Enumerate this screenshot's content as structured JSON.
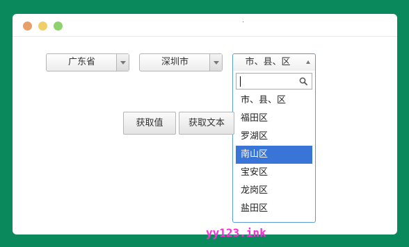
{
  "window": {
    "traffic_lights": [
      {
        "name": "close",
        "color": "#e8a06a"
      },
      {
        "name": "minimize",
        "color": "#f2ce6b"
      },
      {
        "name": "maximize",
        "color": "#8fd16a"
      }
    ]
  },
  "province_select": {
    "value": "广东省"
  },
  "city_select": {
    "value": "深圳市"
  },
  "district_select": {
    "value": "市、县、区",
    "open": true,
    "search_value": "",
    "options": [
      "市、县、区",
      "福田区",
      "罗湖区",
      "南山区",
      "宝安区",
      "龙岗区",
      "盐田区"
    ],
    "highlighted_option": "南山区"
  },
  "buttons": {
    "get_value": "获取值",
    "get_text": "获取文本"
  },
  "watermark": "yy123.ink",
  "colors": {
    "background": "#0a8a5c",
    "highlight": "#3875d7",
    "focus_border": "#5b9bd5",
    "watermark": "#ff2bd6"
  }
}
